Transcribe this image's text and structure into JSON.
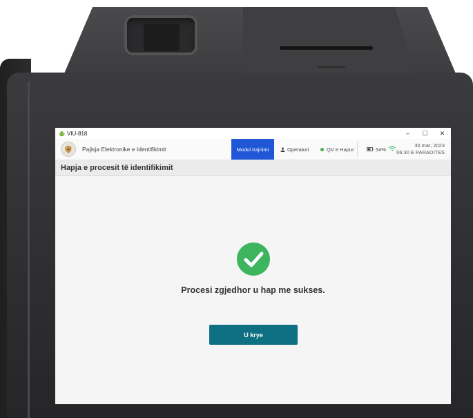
{
  "window": {
    "title": "VIU-818",
    "minimize": "–",
    "maximize": "☐",
    "close": "✕"
  },
  "appbar": {
    "app_name": "Pajisja Elektronike e Identifikimit",
    "mode_tab": "Modul trajnimi",
    "operator": "Operatori",
    "qv_status": "QV e Hapur",
    "battery": "54%",
    "date": "30 mar, 2023",
    "time": "06:30 E PARADITES"
  },
  "page": {
    "title": "Hapja e procesit të identifikimit",
    "message": "Procesi zgjedhor u hap me sukses.",
    "done_button": "U krye"
  },
  "icons": {
    "app": "android-icon",
    "logo": "emblem-icon",
    "operator": "person-icon",
    "status": "green-dot-icon",
    "battery": "battery-icon",
    "wifi": "wifi-icon",
    "success": "check-circle-icon"
  },
  "colors": {
    "mode_tab_bg": "#1f57d6",
    "success_green": "#3cb55e",
    "button_bg": "#0f7083",
    "status_dot": "#4caf50",
    "wifi": "#2db36b"
  }
}
